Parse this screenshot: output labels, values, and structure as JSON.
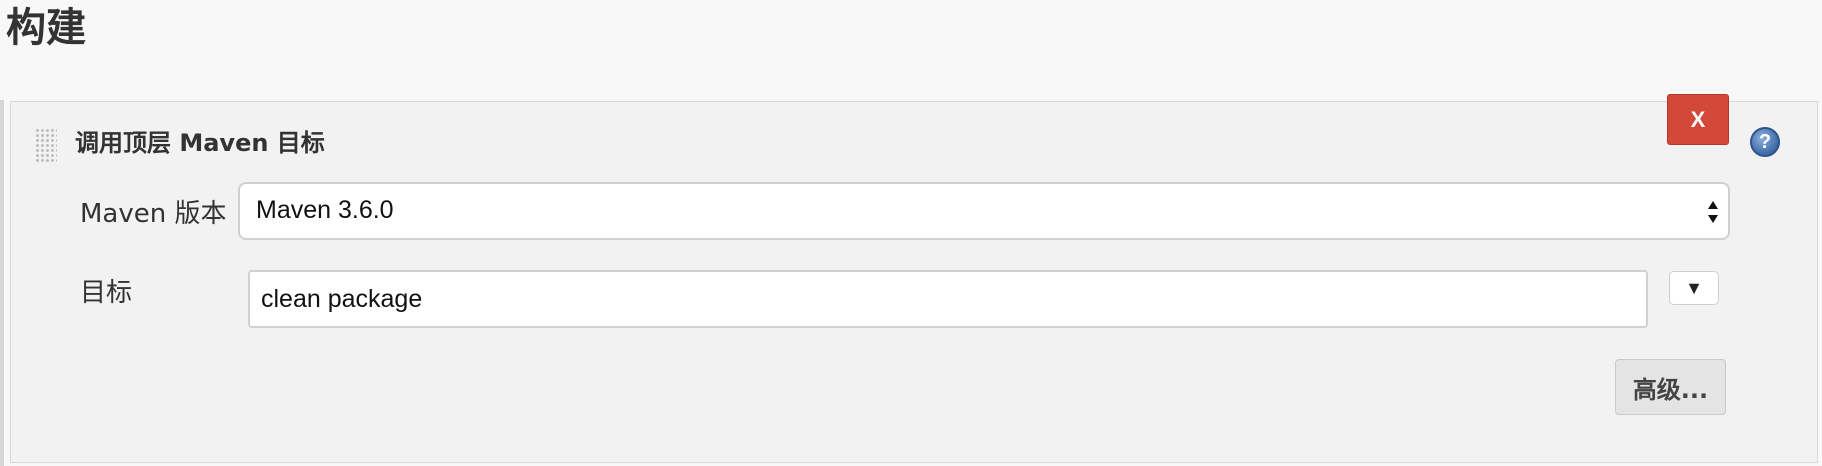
{
  "section": {
    "title": "构建"
  },
  "build_step": {
    "title": "调用顶层 Maven 目标",
    "delete_label": "X",
    "help_label": "?",
    "maven_version": {
      "label": "Maven 版本",
      "selected": "Maven 3.6.0"
    },
    "goals": {
      "label": "目标",
      "value": "clean package",
      "expand_label": "▼"
    },
    "advanced_label": "高级..."
  },
  "colors": {
    "delete_button": "#d24939",
    "help_icon": "#3d6aa8",
    "panel_bg": "#f2f2f2",
    "page_bg": "#f8f8f8"
  },
  "icons": {
    "drag": "drag-handle-icon",
    "help": "help-icon",
    "select": "select-arrows-icon",
    "expand": "expand-down-icon"
  }
}
